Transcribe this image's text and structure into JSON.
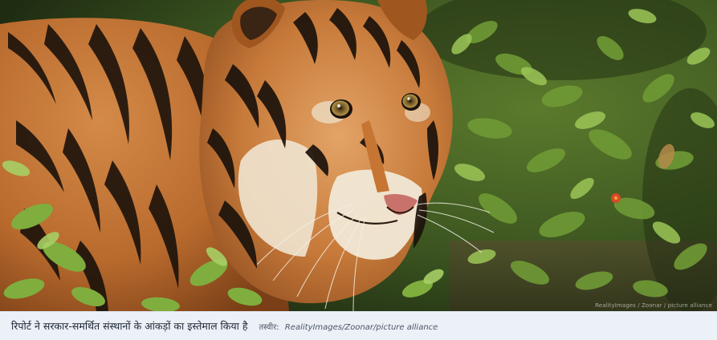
{
  "photo": {
    "subject": "tiger",
    "watermark": "RealityImages / Zoonar / picture alliance"
  },
  "caption": {
    "text": "रिपोर्ट ने सरकार-समर्थित संस्थानों के आंकड़ों का इस्तेमाल किया है",
    "credit_label": "तस्वीर:",
    "credit_value": "RealityImages/Zoonar/picture alliance"
  },
  "colors": {
    "caption_background": "#ecf1f7",
    "caption_text": "#1b2533",
    "credit_text": "#4a5566"
  }
}
